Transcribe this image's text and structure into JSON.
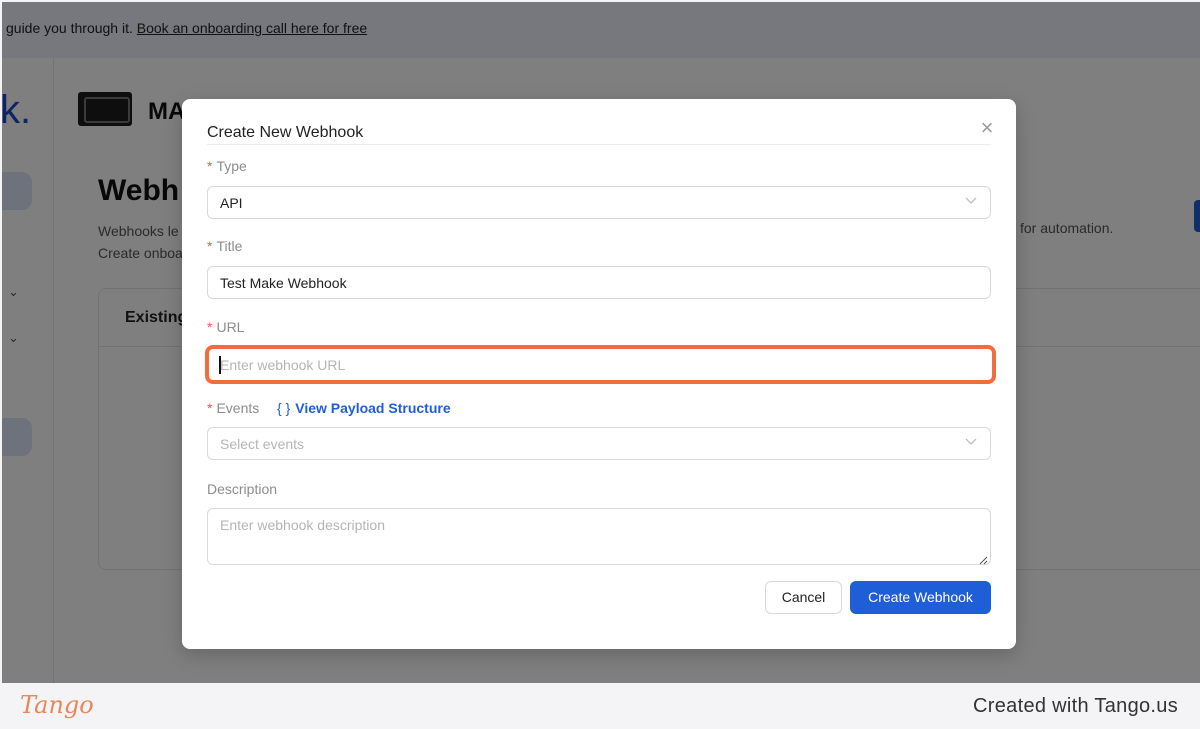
{
  "background": {
    "banner": {
      "text": "guide you through it.",
      "link": "Book an onboarding call here for free"
    },
    "logo_fragment": "sk.",
    "workspace_name": "MA",
    "page_title": "Webh",
    "description_line1": "Webhooks le",
    "description_line2": "Create onboa",
    "description_tail": "for automation.",
    "card_title": "Existing"
  },
  "modal": {
    "title": "Create New Webhook",
    "type": {
      "label": "Type",
      "value": "API"
    },
    "title_field": {
      "label": "Title",
      "value": "Test Make Webhook"
    },
    "url": {
      "label": "URL",
      "placeholder": "Enter webhook URL",
      "value": ""
    },
    "events": {
      "label": "Events",
      "link_brace": "{ }",
      "link_text": "View Payload Structure",
      "placeholder": "Select events"
    },
    "description": {
      "label": "Description",
      "placeholder": "Enter webhook description"
    },
    "cancel_label": "Cancel",
    "create_label": "Create Webhook",
    "required_mark": "*"
  },
  "footer": {
    "logo": "Tango",
    "text": "Created with Tango.us"
  },
  "colors": {
    "accent": "#1e5fd8",
    "highlight": "#f26d3d",
    "required": "#ff4d4f"
  }
}
